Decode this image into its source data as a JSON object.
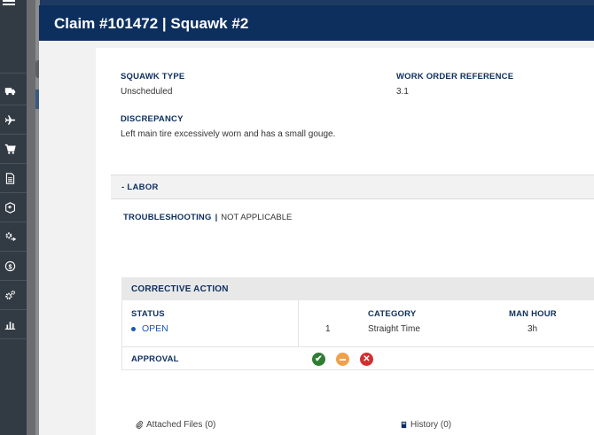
{
  "modal": {
    "title": "Claim #101472 | Squawk #2"
  },
  "details": {
    "squawk_type_label": "SQUAWK TYPE",
    "squawk_type_value": "Unscheduled",
    "work_order_label": "WORK ORDER REFERENCE",
    "work_order_value": "3.1",
    "discrepancy_label": "DISCREPANCY",
    "discrepancy_value": "Left main tire excessively worn and has a small gouge."
  },
  "labor": {
    "section_label": "- LABOR",
    "troubleshooting_label": "TROUBLESHOOTING",
    "troubleshooting_sep": "|",
    "troubleshooting_value": "NOT APPLICABLE"
  },
  "corrective_action": {
    "title": "CORRECTIVE ACTION",
    "status_label": "STATUS",
    "status_value": "OPEN",
    "category_label": "CATEGORY",
    "man_hour_label": "MAN HOUR",
    "row_number": "1",
    "category_value": "Straight Time",
    "man_hour_value": "3h",
    "approval_label": "APPROVAL",
    "attached_files": "Attached Files (0)",
    "history": "History (0)"
  },
  "colors": {
    "header_bg": "#0d2f5e",
    "label_text": "#0d2f5e",
    "link": "#1a56b0",
    "approve": "#2e7d32",
    "pending": "#f0a04b",
    "reject": "#d32f2f",
    "sidenav_bg": "#323a44"
  },
  "sidenav": {
    "icons": [
      "menu-icon",
      "truck-icon",
      "plane-icon",
      "cart-icon",
      "document-icon",
      "box-return-icon",
      "parts-swap-icon",
      "dollar-cycle-icon",
      "gears-icon",
      "bar-chart-icon"
    ]
  }
}
